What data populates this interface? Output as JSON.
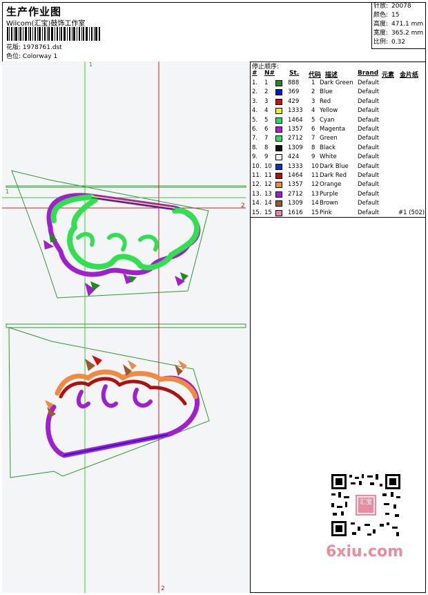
{
  "header": {
    "title": "生产作业图",
    "company": "Wilcom(汇宝)鼓饰工作室",
    "file_label": "花版:",
    "file_value": "1978761.dst",
    "color_label": "色位:",
    "color_value": "Colorway 1"
  },
  "stats": [
    {
      "label": "针放:",
      "value": "20078"
    },
    {
      "label": "颜色:",
      "value": "15"
    },
    {
      "label": "高度:",
      "value": "471.1 mm"
    },
    {
      "label": "宽度:",
      "value": "365.2 mm"
    },
    {
      "label": "比例:",
      "value": "0.32"
    }
  ],
  "markers": {
    "top": "1",
    "left": "1",
    "right": "2",
    "bottom": "2"
  },
  "table": {
    "title": "停止顺序:",
    "headers": {
      "num": "#",
      "n": "N#",
      "st": "St.",
      "code": "代码",
      "desc": "描述",
      "brand": "Brand",
      "elem": "元素",
      "seq": "金片纸"
    },
    "rows": [
      {
        "num": "1.",
        "n": "1",
        "color": "#1e8c1e",
        "st": "888",
        "code": "1",
        "desc": "Dark Green",
        "brand": "Default",
        "elem": ""
      },
      {
        "num": "2.",
        "n": "2",
        "color": "#1010d0",
        "st": "369",
        "code": "2",
        "desc": "Blue",
        "brand": "Default",
        "elem": ""
      },
      {
        "num": "3.",
        "n": "3",
        "color": "#d01010",
        "st": "429",
        "code": "3",
        "desc": "Red",
        "brand": "Default",
        "elem": ""
      },
      {
        "num": "4.",
        "n": "4",
        "color": "#f0f000",
        "st": "1333",
        "code": "4",
        "desc": "Yellow",
        "brand": "Default",
        "elem": ""
      },
      {
        "num": "5.",
        "n": "5",
        "color": "#20e060",
        "st": "1464",
        "code": "5",
        "desc": "Cyan",
        "brand": "Default",
        "elem": ""
      },
      {
        "num": "6.",
        "n": "6",
        "color": "#b020d0",
        "st": "1357",
        "code": "6",
        "desc": "Magenta",
        "brand": "Default",
        "elem": ""
      },
      {
        "num": "7.",
        "n": "7",
        "color": "#30e050",
        "st": "2712",
        "code": "7",
        "desc": "Green",
        "brand": "Default",
        "elem": ""
      },
      {
        "num": "8.",
        "n": "8",
        "color": "#101010",
        "st": "1309",
        "code": "8",
        "desc": "Black",
        "brand": "Default",
        "elem": ""
      },
      {
        "num": "9.",
        "n": "9",
        "color": "#f4f4f4",
        "st": "424",
        "code": "9",
        "desc": "White",
        "brand": "Default",
        "elem": ""
      },
      {
        "num": "10.",
        "n": "10",
        "color": "#1030c8",
        "st": "1333",
        "code": "10",
        "desc": "Dark Blue",
        "brand": "Default",
        "elem": ""
      },
      {
        "num": "11.",
        "n": "11",
        "color": "#b01010",
        "st": "1464",
        "code": "11",
        "desc": "Dark Red",
        "brand": "Default",
        "elem": ""
      },
      {
        "num": "12.",
        "n": "12",
        "color": "#f08a40",
        "st": "1357",
        "code": "12",
        "desc": "Orange",
        "brand": "Default",
        "elem": ""
      },
      {
        "num": "13.",
        "n": "13",
        "color": "#a020d0",
        "st": "2712",
        "code": "13",
        "desc": "Purple",
        "brand": "Default",
        "elem": ""
      },
      {
        "num": "14.",
        "n": "14",
        "color": "#9a5a30",
        "st": "1309",
        "code": "14",
        "desc": "Brown",
        "brand": "Default",
        "elem": ""
      },
      {
        "num": "15.",
        "n": "15",
        "color": "#f080b0",
        "st": "1616",
        "code": "15",
        "desc": "Pink",
        "brand": "Default",
        "elem": "#1 (502)"
      }
    ]
  },
  "watermark": "6xiu.com",
  "qr_text": "汇宝"
}
